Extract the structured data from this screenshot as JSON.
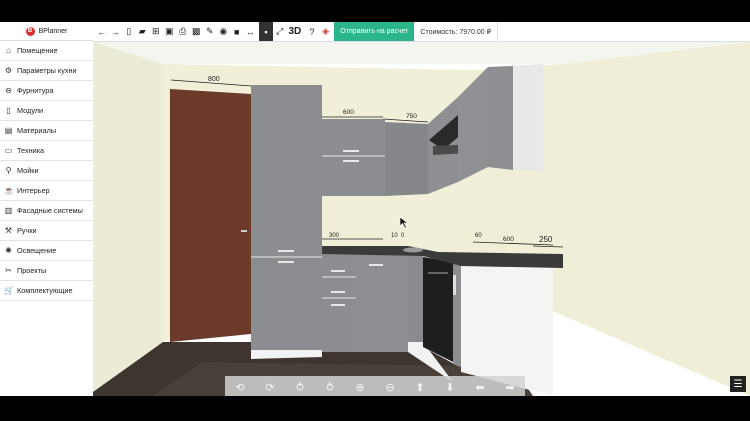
{
  "logo": {
    "text": "BPlanner",
    "mark": "B"
  },
  "sidebar": {
    "items": [
      {
        "label": "Помещение",
        "icon": "home-icon",
        "glyph": "⌂"
      },
      {
        "label": "Параметры кухни",
        "icon": "gear-icon",
        "glyph": "⚙"
      },
      {
        "label": "Фурнитура",
        "icon": "hinge-icon",
        "glyph": "⊖"
      },
      {
        "label": "Модули",
        "icon": "module-icon",
        "glyph": "▯"
      },
      {
        "label": "Материалы",
        "icon": "materials-icon",
        "glyph": "▤"
      },
      {
        "label": "Техника",
        "icon": "monitor-icon",
        "glyph": "▭"
      },
      {
        "label": "Мойки",
        "icon": "faucet-icon",
        "glyph": "⚲"
      },
      {
        "label": "Интерьер",
        "icon": "cup-icon",
        "glyph": "☕"
      },
      {
        "label": "Фасадные системы",
        "icon": "facade-icon",
        "glyph": "▥"
      },
      {
        "label": "Ручки",
        "icon": "handle-icon",
        "glyph": "⚒"
      },
      {
        "label": "Освещение",
        "icon": "light-icon",
        "glyph": "✺"
      },
      {
        "label": "Проекты",
        "icon": "tools-icon",
        "glyph": "✂"
      },
      {
        "label": "Комплектующие",
        "icon": "cart-icon",
        "glyph": "🛒"
      }
    ]
  },
  "toolbar": {
    "icons": [
      {
        "name": "undo-icon",
        "glyph": "←"
      },
      {
        "name": "redo-icon",
        "glyph": "→"
      },
      {
        "name": "new-file-icon",
        "glyph": "▯"
      },
      {
        "name": "open-folder-icon",
        "glyph": "▰"
      },
      {
        "name": "save-tree-icon",
        "glyph": "⊞"
      },
      {
        "name": "save-icon",
        "glyph": "▣"
      },
      {
        "name": "print-icon",
        "glyph": "⎙"
      },
      {
        "name": "image-icon",
        "glyph": "▩"
      },
      {
        "name": "pencil-icon",
        "glyph": "✎"
      },
      {
        "name": "eye-icon",
        "glyph": "◉"
      },
      {
        "name": "camera-icon",
        "glyph": "■"
      },
      {
        "name": "measure-icon",
        "glyph": "↔"
      }
    ],
    "icons2": [
      {
        "name": "comment-icon",
        "glyph": "▪",
        "dark": true
      },
      {
        "name": "fullscreen-icon",
        "glyph": "⤢"
      }
    ],
    "label_3d": "3D",
    "icons3": [
      {
        "name": "help-icon",
        "glyph": "?"
      },
      {
        "name": "cart-red-icon",
        "glyph": "◈",
        "red": true
      }
    ],
    "send_label": "Отправить на расчет",
    "price_label": "Стоимость: 7970.00 ₽"
  },
  "dimensions": {
    "d800": "800",
    "d600a": "600",
    "d750": "750",
    "d300": "300",
    "d10": "10",
    "d0": "0",
    "d60": "60",
    "d600b": "600",
    "d250": "250"
  },
  "controls": [
    {
      "name": "rotate-left-icon",
      "glyph": "⟲"
    },
    {
      "name": "rotate-right-icon",
      "glyph": "⟳"
    },
    {
      "name": "tilt-up-icon",
      "glyph": "⥀"
    },
    {
      "name": "tilt-down-icon",
      "glyph": "⥁"
    },
    {
      "name": "zoom-in-icon",
      "glyph": "⊕"
    },
    {
      "name": "zoom-out-icon",
      "glyph": "⊖"
    },
    {
      "name": "move-up-icon",
      "glyph": "⬆"
    },
    {
      "name": "move-down-icon",
      "glyph": "⬇"
    },
    {
      "name": "move-left-icon",
      "glyph": "⬅"
    },
    {
      "name": "move-right-icon",
      "glyph": "➡"
    }
  ],
  "list_button": {
    "glyph": "☰"
  },
  "colors": {
    "accent": "#2bb58a",
    "brand": "#d32f2f",
    "cabinet": "#8c8d90",
    "worktop": "#3a3a3a",
    "floor": "#3e3530",
    "door": "#6b3a2a"
  }
}
